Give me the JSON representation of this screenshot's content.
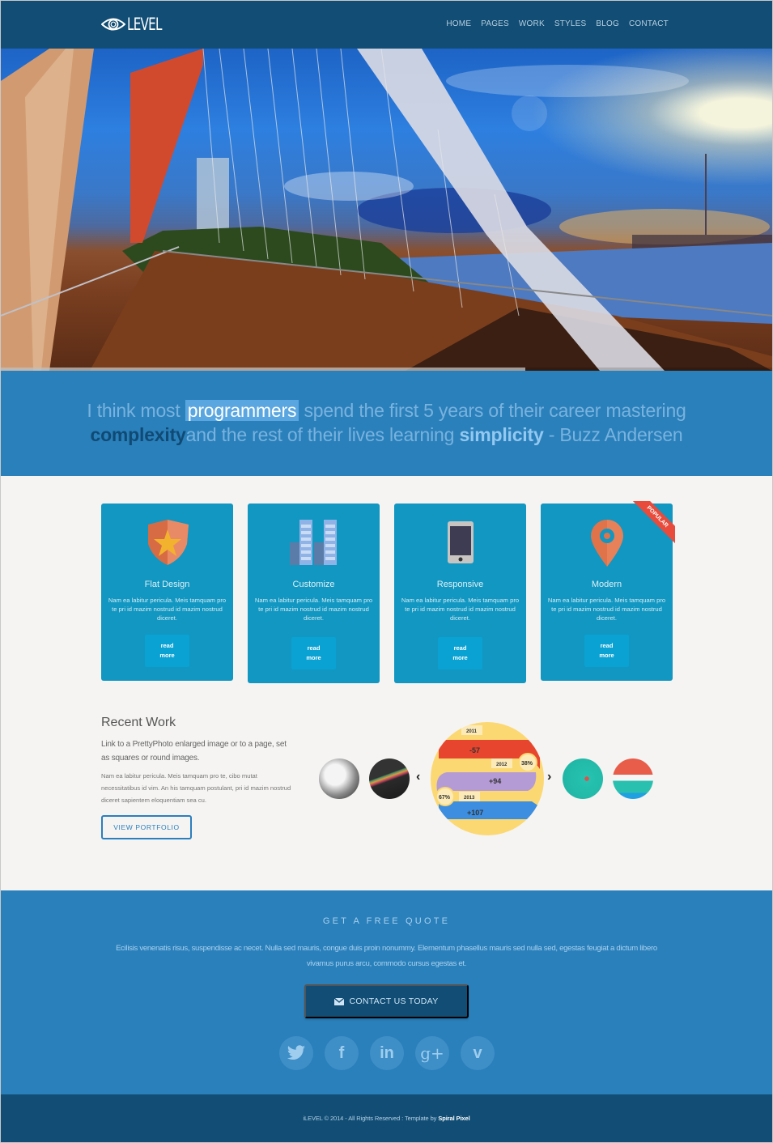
{
  "header": {
    "logo_text": "LEVEL",
    "nav": [
      "HOME",
      "PAGES",
      "WORK",
      "STYLES",
      "BLOG",
      "CONTACT"
    ]
  },
  "hero": {
    "image_description": "Bridge with cable arch over a river at sunset, city skyline in distance",
    "slider_progress_percent": 68
  },
  "quote": {
    "part1": "I think most ",
    "highlight": "programmers",
    "part2": " spend the first 5 years of their career mastering",
    "dark_word": "complexity",
    "part3": "and the rest of their lives learning ",
    "bold_word": "simplicity",
    "part4": " - Buzz Andersen"
  },
  "features": [
    {
      "icon": "shield-star-icon",
      "title": "Flat Design",
      "text": "Nam ea labitur pericula. Meis tamquam pro te pri id mazim nostrud id mazim nostrud diceret.",
      "button": "read more"
    },
    {
      "icon": "buildings-icon",
      "title": "Customize",
      "text": "Nam ea labitur pericula. Meis tamquam pro te pri id mazim nostrud id mazim nostrud diceret.",
      "button": "read more"
    },
    {
      "icon": "smartphone-icon",
      "title": "Responsive",
      "text": "Nam ea labitur pericula. Meis tamquam pro te pri id mazim nostrud id mazim nostrud diceret.",
      "button": "read more"
    },
    {
      "icon": "map-pin-icon",
      "title": "Modern",
      "text": "Nam ea labitur pericula. Meis tamquam pro te pri id mazim nostrud id mazim nostrud diceret.",
      "button": "read more",
      "ribbon": "POPULAR"
    }
  ],
  "recent_work": {
    "title": "Recent Work",
    "subtitle": "Link to a PrettyPhoto enlarged image or to a page, set as squares or round images.",
    "text": "Nam ea labitur pericula. Meis tamquam pro te, cibo mutat necessitatibus id vim. An his tamquam postulant, pri id mazim nostrud diceret sapientem eloquentiam sea cu.",
    "button": "VIEW PORTFOLIO",
    "prev_arrow": "‹",
    "next_arrow": "›",
    "infographic": {
      "years": [
        "2011",
        "2012",
        "2013"
      ],
      "values": [
        "-57",
        "+94",
        "+107"
      ],
      "percents": [
        "38%",
        "67%"
      ]
    }
  },
  "cta": {
    "title": "GET A FREE QUOTE",
    "text": "Ecilisis venenatis risus, suspendisse ac necet. Nulla sed mauris, congue duis proin nonummy. Elementum phasellus mauris sed nulla sed, egestas feugiat a dictum libero vivamus purus arcu, commodo cursus egestas et.",
    "button": "CONTACT US TODAY",
    "socials": [
      "twitter",
      "facebook",
      "linkedin",
      "google-plus",
      "vimeo"
    ],
    "social_glyphs": [
      "t",
      "f",
      "in",
      "g+",
      "v"
    ]
  },
  "footer": {
    "text": "iLEVEL © 2014 - All Rights Reserved : Template by ",
    "author": "Spiral Pixel"
  },
  "colors": {
    "header_bg": "#114d74",
    "quote_bg": "#2a80bb",
    "card_bg": "#1197c1",
    "ribbon": "#e84b3c",
    "accent": "#2a7fbd"
  }
}
